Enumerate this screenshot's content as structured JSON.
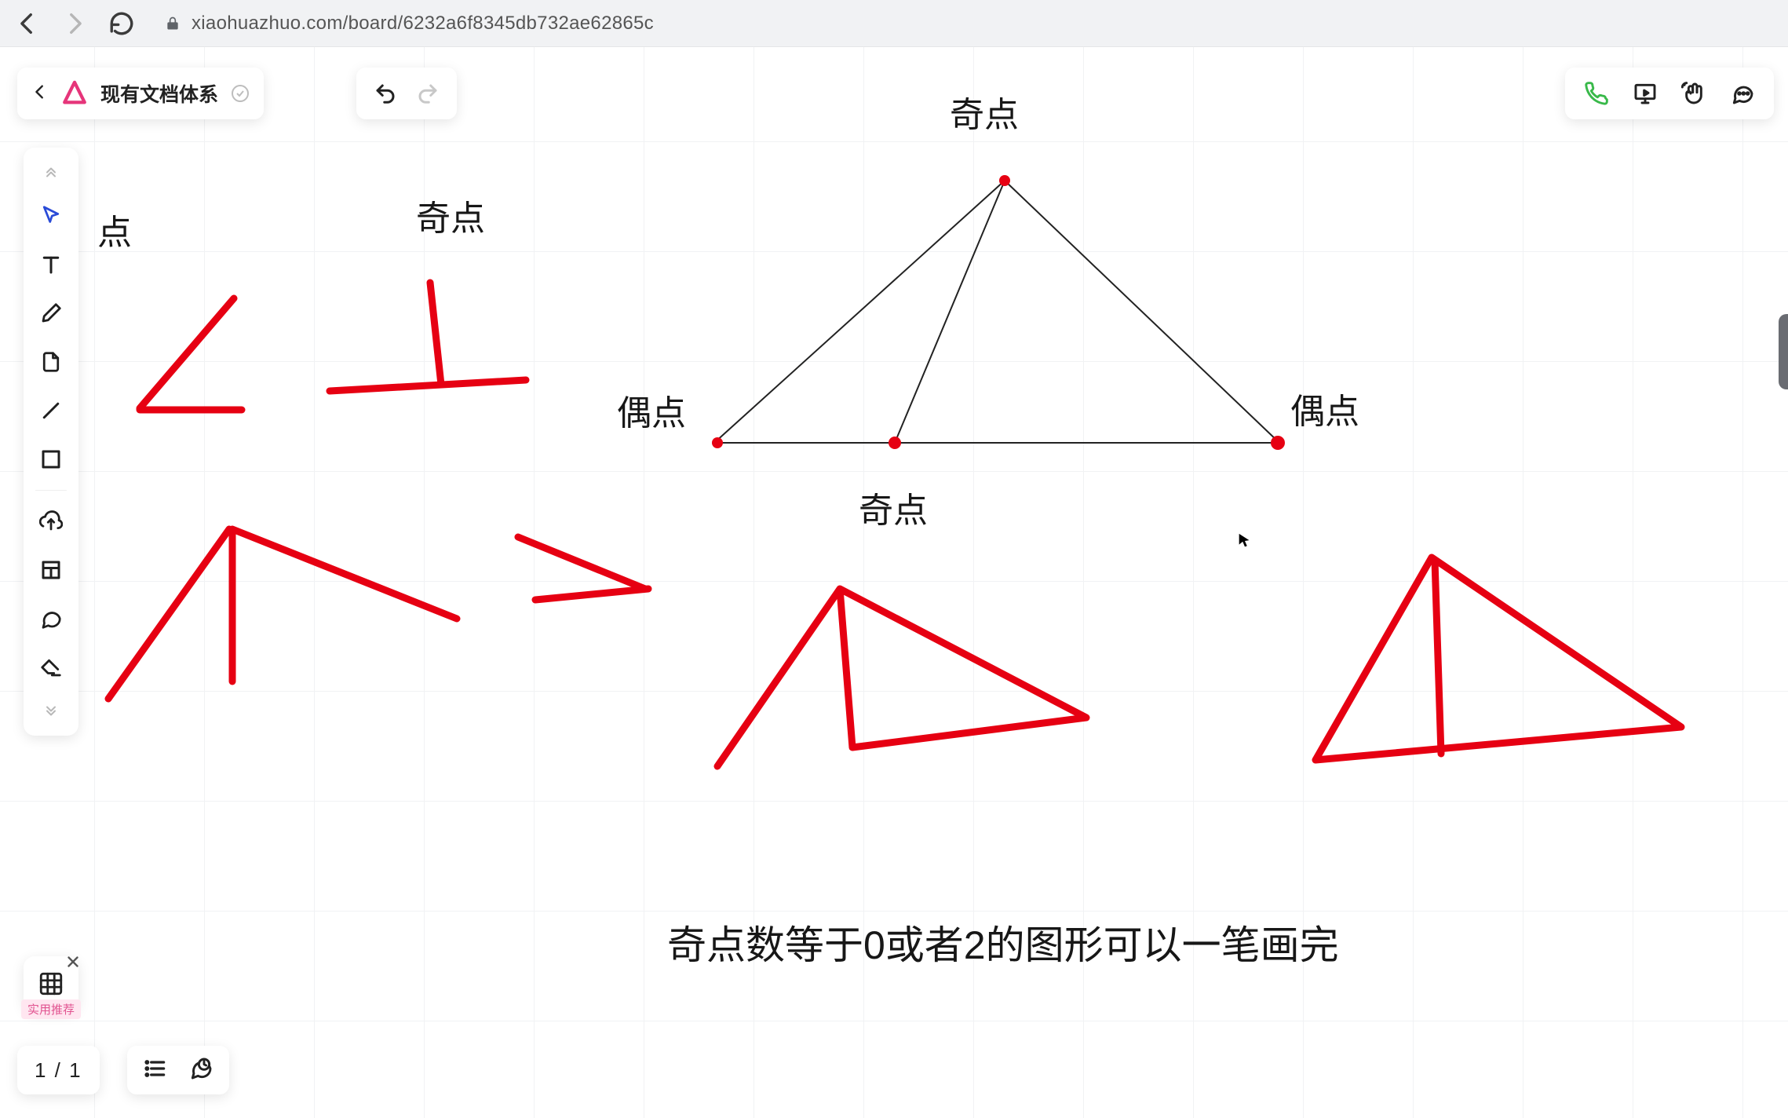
{
  "browser": {
    "url": "xiaohuazhuo.com/board/6232a6f8345db732ae62865c"
  },
  "header": {
    "title": "现有文档体系"
  },
  "aux": {
    "badge": "实用推荐"
  },
  "pager": {
    "label": "1 / 1"
  },
  "canvas": {
    "labels": {
      "top_odd": "奇点",
      "left_odd_trunc": "点",
      "mid_odd": "奇点",
      "tri_top": "奇点",
      "tri_left": "偶点",
      "tri_right": "偶点",
      "tri_bottom": "奇点",
      "note": "奇点数等于0或者2的图形可以一笔画完"
    }
  }
}
